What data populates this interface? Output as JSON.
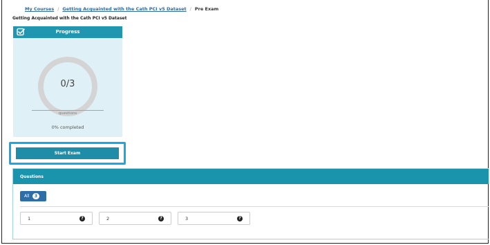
{
  "breadcrumb": {
    "my_courses": "My Courses",
    "sep1": "/",
    "course": "Getting Acquainted with the Cath PCI v5 Dataset",
    "sep2": "/",
    "current": "Pre Exam"
  },
  "course_title": "Getting Acquainted with the Cath PCI v5 Dataset",
  "progress": {
    "header_title": "Progress",
    "header_icon": "check-square-icon",
    "count": "0/3",
    "answered_fraction": 0,
    "questions_label": "questions",
    "completed_label": "0% completed",
    "start_button": "Start Exam"
  },
  "questions": {
    "header_title": "Questions",
    "filter_all_label": "All",
    "filter_all_count": "3",
    "items": [
      {
        "number": "1",
        "help_icon": "question-circle-icon",
        "help_glyph": "?"
      },
      {
        "number": "2",
        "help_icon": "question-circle-icon",
        "help_glyph": "?"
      },
      {
        "number": "3",
        "help_icon": "question-circle-icon",
        "help_glyph": "?"
      }
    ]
  },
  "colors": {
    "accent": "#2196b0",
    "card_bg": "#dff1f7",
    "highlight": "#16a9e8",
    "link": "#2c6aa8",
    "ring": "#d4d4d4"
  }
}
